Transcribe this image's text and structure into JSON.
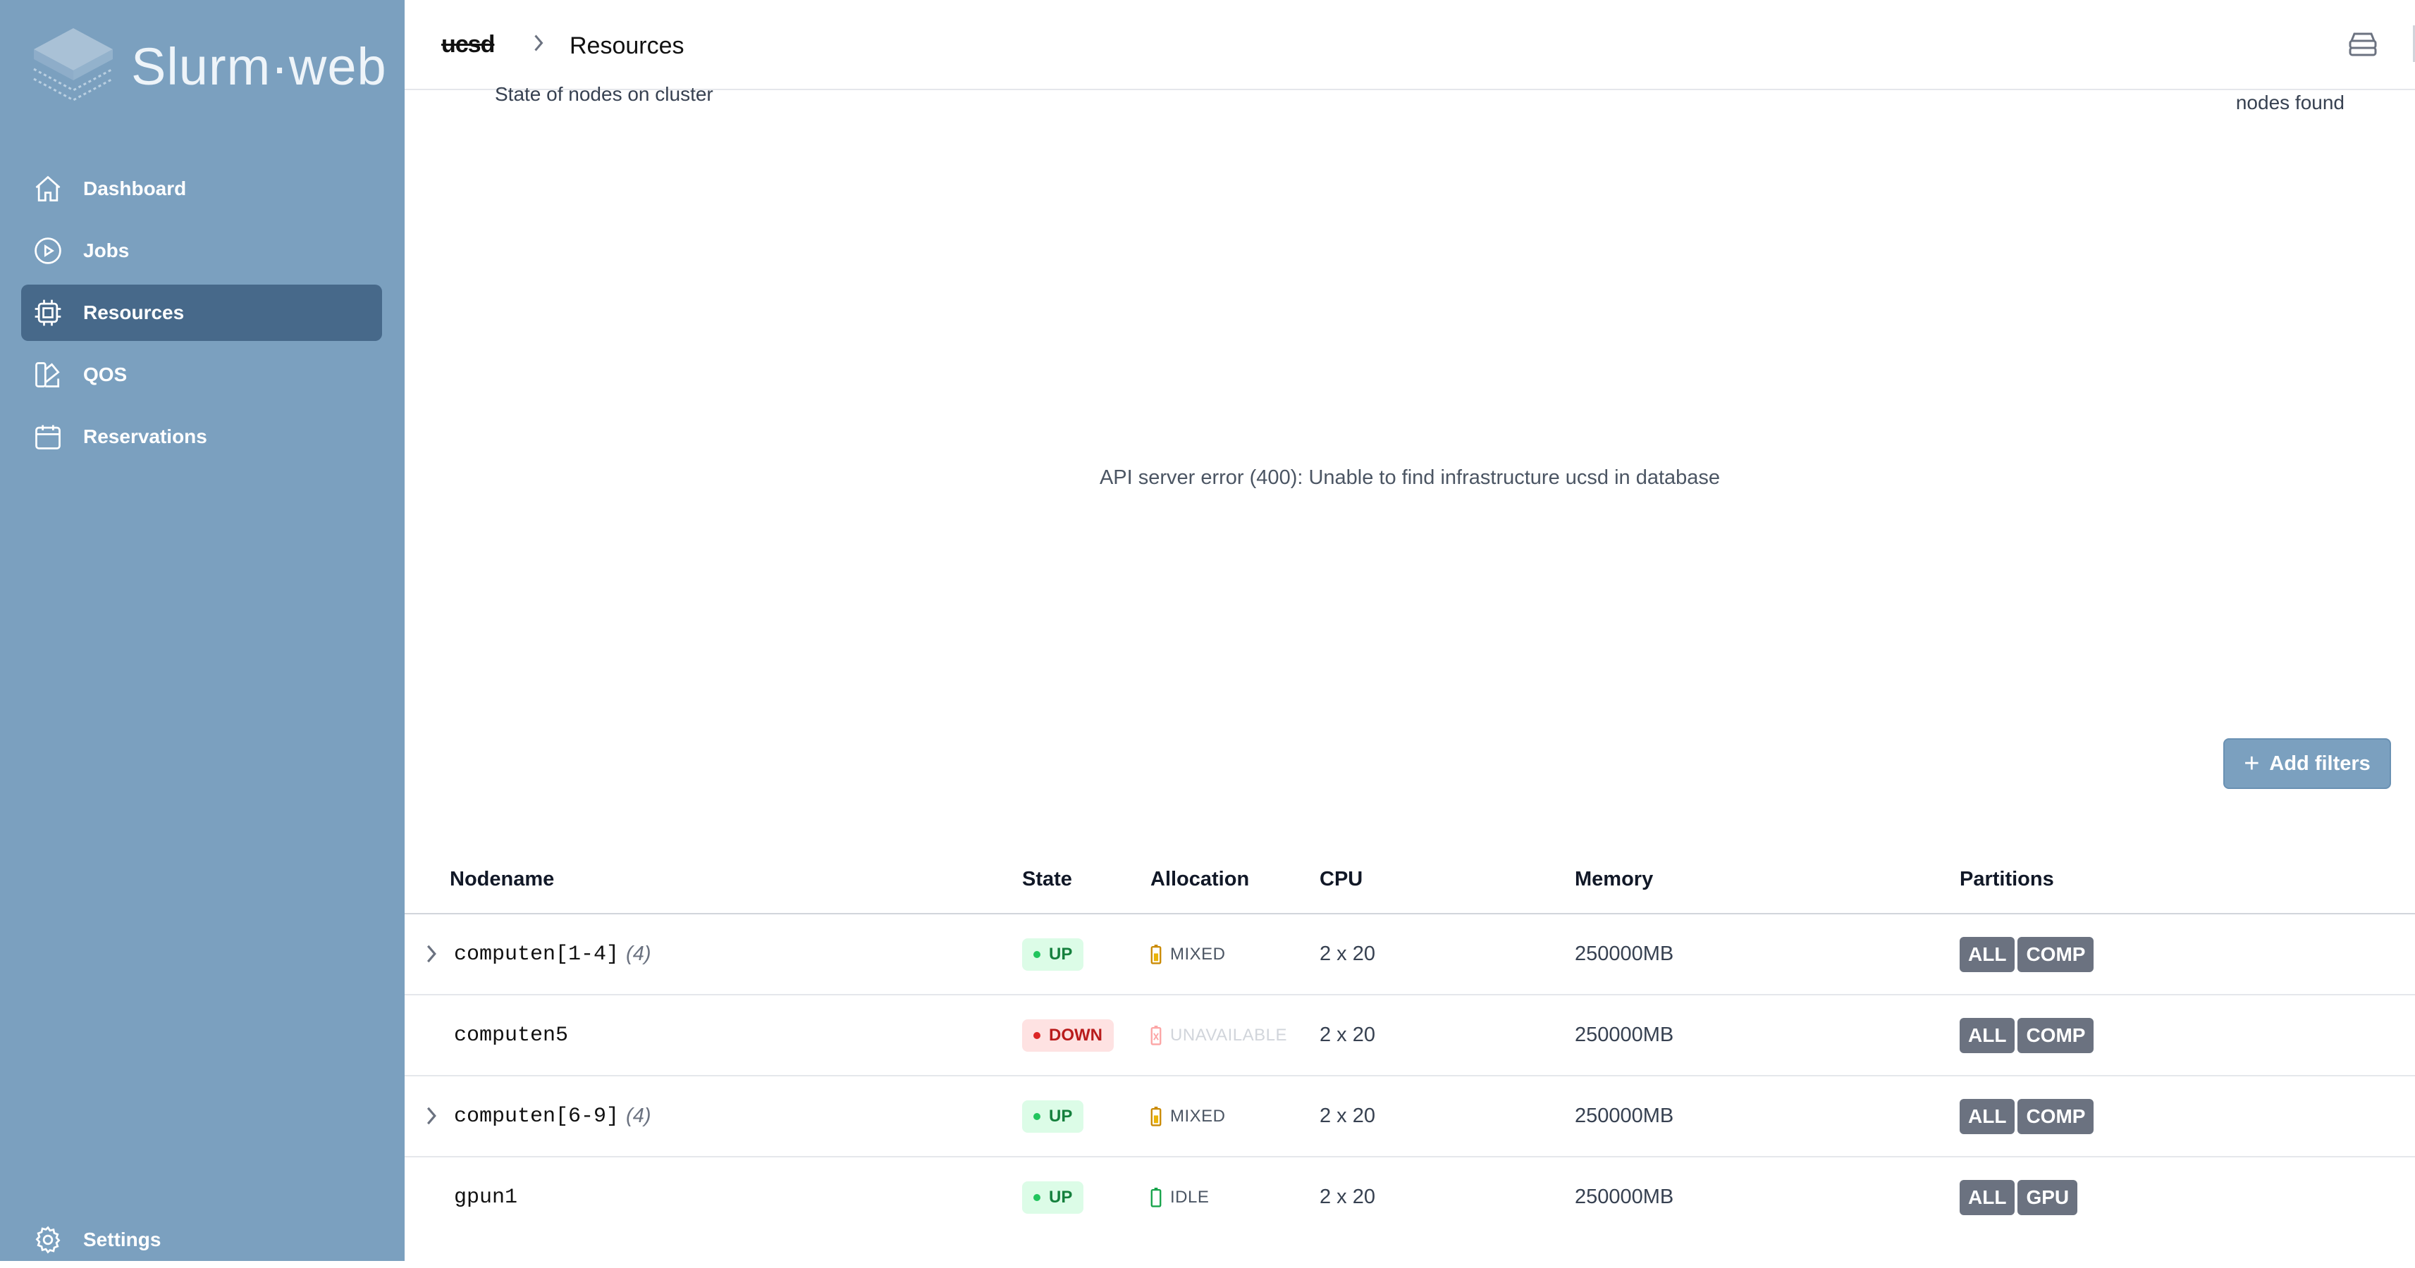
{
  "app": {
    "name": "Slurm·web"
  },
  "sidebar": {
    "items": [
      {
        "label": "Dashboard",
        "icon": "home-icon"
      },
      {
        "label": "Jobs",
        "icon": "play-circle-icon"
      },
      {
        "label": "Resources",
        "icon": "cpu-chip-icon",
        "active": true
      },
      {
        "label": "QOS",
        "icon": "swatch-icon"
      },
      {
        "label": "Reservations",
        "icon": "calendar-icon"
      }
    ],
    "settings_label": "Settings"
  },
  "header": {
    "cluster_crumb": "ucsd",
    "current_crumb": "Resources"
  },
  "page": {
    "subtitle": "State of nodes on cluster",
    "nodes_found": "nodes found",
    "error": "API server error (400): Unable to find infrastructure ucsd in database",
    "add_filters_label": "Add filters"
  },
  "table": {
    "columns": [
      "Nodename",
      "State",
      "Allocation",
      "CPU",
      "Memory",
      "Partitions"
    ],
    "rows": [
      {
        "nodename": "computen[1-4]",
        "count": "(4)",
        "state": "UP",
        "allocation": "MIXED",
        "cpu": "2 x 20",
        "memory": "250000MB",
        "partitions": [
          "ALL",
          "COMP"
        ]
      },
      {
        "nodename": "computen5",
        "count": "",
        "state": "DOWN",
        "allocation": "UNAVAILABLE",
        "cpu": "2 x 20",
        "memory": "250000MB",
        "partitions": [
          "ALL",
          "COMP"
        ]
      },
      {
        "nodename": "computen[6-9]",
        "count": "(4)",
        "state": "UP",
        "allocation": "MIXED",
        "cpu": "2 x 20",
        "memory": "250000MB",
        "partitions": [
          "ALL",
          "COMP"
        ]
      },
      {
        "nodename": "gpun1",
        "count": "",
        "state": "UP",
        "allocation": "IDLE",
        "cpu": "2 x 20",
        "memory": "250000MB",
        "partitions": [
          "ALL",
          "GPU"
        ]
      }
    ]
  },
  "colors": {
    "sidebar_bg": "#7ba0bf",
    "sidebar_active": "#47698a",
    "up_bg": "#dcfce7",
    "up_text": "#15803d",
    "down_bg": "#fee2e2",
    "down_text": "#b91c1c",
    "partition_bg": "#6b7280"
  }
}
